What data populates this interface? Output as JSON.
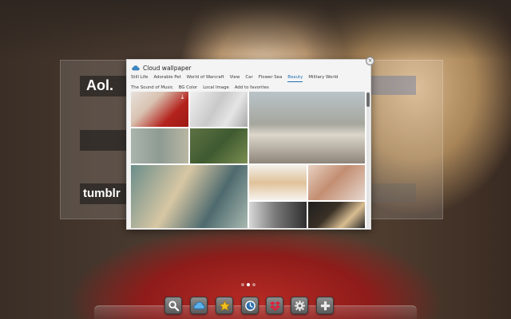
{
  "dialog": {
    "title": "Cloud wallpaper",
    "close_glyph": "×",
    "tabs": [
      {
        "label": "Still Life",
        "active": false
      },
      {
        "label": "Adorable Pet",
        "active": false
      },
      {
        "label": "World of Warcraft",
        "active": false
      },
      {
        "label": "View",
        "active": false
      },
      {
        "label": "Car",
        "active": false
      },
      {
        "label": "Flower Sea",
        "active": false
      },
      {
        "label": "Beauty",
        "active": true
      },
      {
        "label": "Military World",
        "active": false
      },
      {
        "label": "The Sound of Music",
        "active": false
      },
      {
        "label": "BG Color",
        "active": false
      },
      {
        "label": "Local Image",
        "active": false
      },
      {
        "label": "Add to favorites",
        "active": false
      }
    ],
    "download_icon": "download-icon"
  },
  "background_tiles": {
    "aol": "Aol.",
    "tumblr": "tumblr"
  },
  "pager": {
    "pages": 3,
    "current": 1
  },
  "dock": {
    "icons": [
      "search-icon",
      "cloud-icon",
      "star-icon",
      "clock-icon",
      "dropbox-icon",
      "gear-icon",
      "plus-icon"
    ]
  },
  "colors": {
    "accent": "#1d6fb5",
    "dialog_bg": "#f4f4f4"
  }
}
